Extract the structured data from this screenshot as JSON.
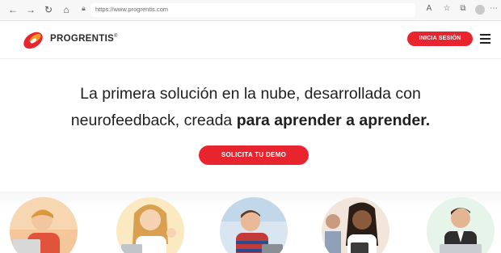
{
  "browser": {
    "url": "https://www.progrentis.com",
    "icons": [
      "back-arrow-icon",
      "forward-arrow-icon",
      "reload-icon",
      "home-icon",
      "lock-icon",
      "read-aloud-icon",
      "favorites-icon",
      "collections-icon",
      "profile-icon",
      "more-icon"
    ]
  },
  "header": {
    "brand": "PROGRENTIS",
    "brand_mark": "®",
    "login_label": "INICIA SESIÓN",
    "menu_icon": "hamburger-menu-icon"
  },
  "hero": {
    "headline_line1": "La primera solución en la nube, desarrollada con",
    "headline_line2_normal": "neurofeedback, creada",
    "headline_line2_bold": "para aprender a aprender.",
    "cta_label": "SOLICITA TU DEMO"
  },
  "colors": {
    "brand_red": "#e8252e",
    "logo_orange": "#f29a1d",
    "text_dark": "#1f1f1f"
  },
  "photos": [
    {
      "name": "photo-student-boy-laptop"
    },
    {
      "name": "photo-girl-thumbs-up"
    },
    {
      "name": "photo-boy-headphones"
    },
    {
      "name": "photo-young-woman-tablet"
    },
    {
      "name": "photo-young-man-laptop"
    }
  ]
}
